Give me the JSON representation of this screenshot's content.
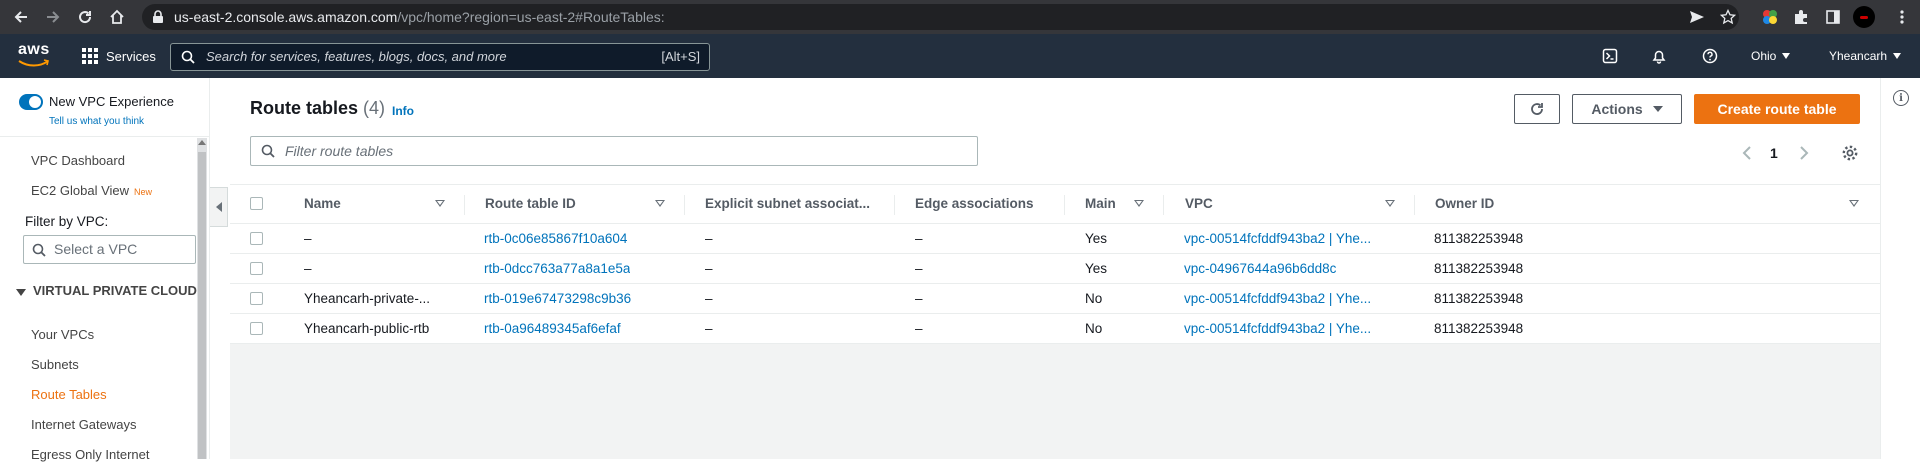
{
  "browser": {
    "url_host": "us-east-2.console.aws.amazon.com",
    "url_path": "/vpc/home?region=us-east-2#RouteTables:"
  },
  "aws_bar": {
    "logo_text": "aws",
    "services_label": "Services",
    "search_placeholder": "Search for services, features, blogs, docs, and more",
    "search_shortcut": "[Alt+S]",
    "region": "Ohio",
    "account": "Yheancarh"
  },
  "sidebar": {
    "new_vpc_experience": "New VPC Experience",
    "tell_us": "Tell us what you think",
    "vpc_dashboard": "VPC Dashboard",
    "ec2_global_view": "EC2 Global View",
    "new_badge": "New",
    "filter_by_vpc": "Filter by VPC:",
    "select_vpc_placeholder": "Select a VPC",
    "section_heading": "VIRTUAL PRIVATE CLOUD",
    "items": [
      {
        "label": "Your VPCs",
        "active": false
      },
      {
        "label": "Subnets",
        "active": false
      },
      {
        "label": "Route Tables",
        "active": true
      },
      {
        "label": "Internet Gateways",
        "active": false
      },
      {
        "label": "Egress Only Internet",
        "active": false
      }
    ]
  },
  "main": {
    "title": "Route tables",
    "count": "(4)",
    "info": "Info",
    "actions_label": "Actions",
    "create_label": "Create route table",
    "filter_placeholder": "Filter route tables",
    "page_number": "1",
    "columns": [
      "Name",
      "Route table ID",
      "Explicit subnet associat...",
      "Edge associations",
      "Main",
      "VPC",
      "Owner ID"
    ],
    "rows": [
      {
        "name": "–",
        "rtb_id": "rtb-0c06e85867f10a604",
        "explicit": "–",
        "edge": "–",
        "main": "Yes",
        "vpc": "vpc-00514fcfddf943ba2 | Yhe...",
        "owner": "811382253948"
      },
      {
        "name": "–",
        "rtb_id": "rtb-0dcc763a77a8a1e5a",
        "explicit": "–",
        "edge": "–",
        "main": "Yes",
        "vpc": "vpc-04967644a96b6dd8c",
        "owner": "811382253948"
      },
      {
        "name": "Yheancarh-private-...",
        "rtb_id": "rtb-019e67473298c9b36",
        "explicit": "–",
        "edge": "–",
        "main": "No",
        "vpc": "vpc-00514fcfddf943ba2 | Yhe...",
        "owner": "811382253948"
      },
      {
        "name": "Yheancarh-public-rtb",
        "rtb_id": "rtb-0a96489345af6efaf",
        "explicit": "–",
        "edge": "–",
        "main": "No",
        "vpc": "vpc-00514fcfddf943ba2 | Yhe...",
        "owner": "811382253948"
      }
    ]
  },
  "colors": {
    "accent_orange": "#ec7211",
    "link_blue": "#0073bb",
    "aws_nav": "#232f3e"
  }
}
